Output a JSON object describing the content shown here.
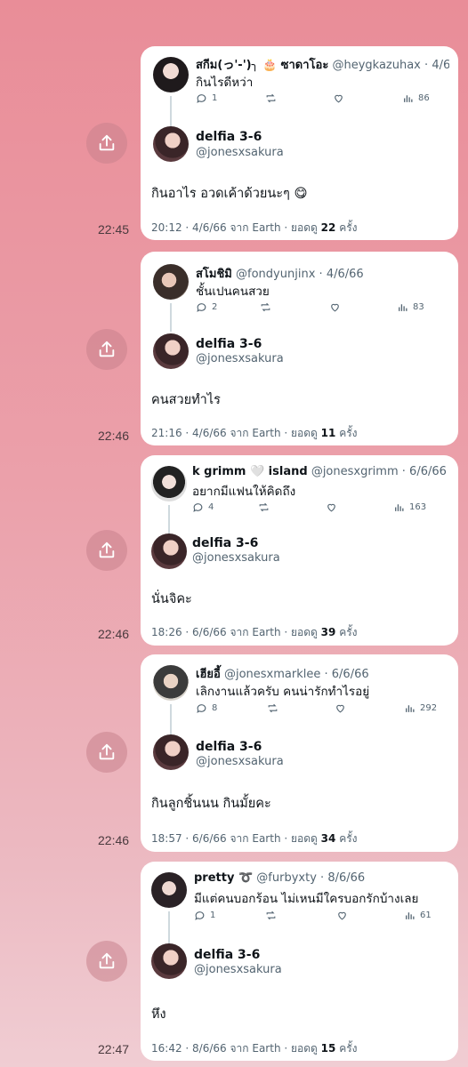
{
  "self": {
    "name": "delfia 3-6",
    "handle": "@jonesxsakura"
  },
  "footer_labels": {
    "from": "จาก",
    "source": "Earth",
    "views": "ยอดดู",
    "times": "ครั้ง"
  },
  "threads": [
    {
      "sent_time": "22:45",
      "quoted": {
        "name": "สกีม(っ'-')╮ 🎂 ซาดาโอะ",
        "handle": "@heygkazuhax",
        "date": "4/6/66",
        "text": "กินไรดีหว่า",
        "replies": "1",
        "views": "86"
      },
      "reply": "กินอาไร อวดเค้าด้วยนะๆ 😋",
      "footer": {
        "time": "20:12",
        "date": "4/6/66",
        "views": "22"
      }
    },
    {
      "sent_time": "22:46",
      "quoted": {
        "name": "สโมชิมิ",
        "handle": "@fondyunjinx",
        "date": "4/6/66",
        "text": "ชั้นเปนคนสวย",
        "replies": "2",
        "views": "83"
      },
      "reply": "คนสวยทำไร",
      "footer": {
        "time": "21:16",
        "date": "4/6/66",
        "views": "11"
      }
    },
    {
      "sent_time": "22:46",
      "quoted": {
        "name": "k grimm 🤍 island",
        "handle": "@jonesxgrimm",
        "date": "6/6/66",
        "text": "อยากมีแฟนให้คิดถึง",
        "replies": "4",
        "views": "163"
      },
      "reply": "นั่นจิคะ",
      "footer": {
        "time": "18:26",
        "date": "6/6/66",
        "views": "39"
      }
    },
    {
      "sent_time": "22:46",
      "quoted": {
        "name": "เฮียอี้",
        "handle": "@jonesxmarklee",
        "date": "6/6/66",
        "text": "เลิกงานแล้วครับ คนน่ารักทำไรอยู่",
        "replies": "8",
        "views": "292"
      },
      "reply": "กินลูกชิ้นนน กินมั้ยคะ",
      "footer": {
        "time": "18:57",
        "date": "6/6/66",
        "views": "34"
      }
    },
    {
      "sent_time": "22:47",
      "quoted": {
        "name": "pretty ➰",
        "handle": "@furbyxty",
        "date": "8/6/66",
        "text": "มีแต่คนบอกร้อน ไม่เหนมีใครบอกรักบ้างเลย",
        "replies": "1",
        "views": "61"
      },
      "reply": "หึง",
      "footer": {
        "time": "16:42",
        "date": "8/6/66",
        "views": "15"
      }
    }
  ]
}
